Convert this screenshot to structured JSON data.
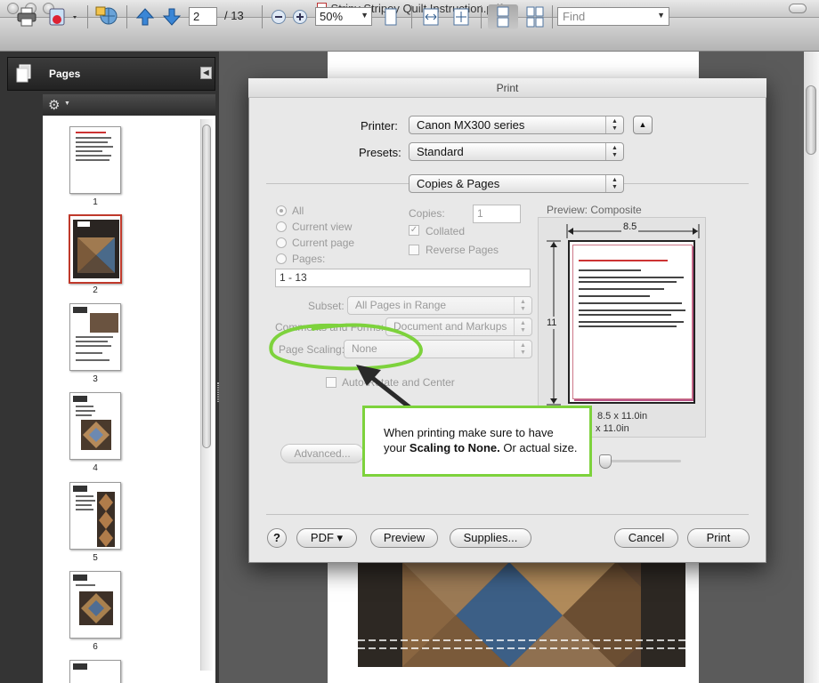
{
  "window": {
    "title": "Stripy Stripey Quilt Instruction.pdf"
  },
  "toolbar": {
    "page_current": "2",
    "page_total": "/ 13",
    "zoom": "50%",
    "find_placeholder": "Find"
  },
  "sidebar": {
    "title": "Pages",
    "thumbnails": [
      {
        "label": "1",
        "selected": false
      },
      {
        "label": "2",
        "selected": true
      },
      {
        "label": "3",
        "selected": false
      },
      {
        "label": "4",
        "selected": false
      },
      {
        "label": "5",
        "selected": false
      },
      {
        "label": "6",
        "selected": false
      }
    ]
  },
  "print_dialog": {
    "title": "Print",
    "printer_label": "Printer:",
    "printer_value": "Canon MX300 series",
    "presets_label": "Presets:",
    "presets_value": "Standard",
    "panel_value": "Copies & Pages",
    "range": {
      "all": "All",
      "current_view": "Current view",
      "current_page": "Current page",
      "pages": "Pages:",
      "pages_value": "1 - 13"
    },
    "copies_label": "Copies:",
    "copies_value": "1",
    "collated_label": "Collated",
    "reverse_label": "Reverse Pages",
    "subset_label": "Subset:",
    "subset_value": "All Pages in Range",
    "comments_label": "Comments and Forms:",
    "comments_value": "Document and Markups",
    "scaling_label": "Page Scaling:",
    "scaling_value": "None",
    "auto_rotate_label": "Auto-Rotate and Center",
    "preview_label": "Preview: Composite",
    "preview_width": "8.5",
    "preview_height": "11",
    "preview_size_line1": "8.5 x 11.0in",
    "preview_size_line2": "x 11.0in",
    "advanced_button": "Advanced...",
    "help_button": "?",
    "pdf_button": "PDF ▾",
    "preview_button": "Preview",
    "supplies_button": "Supplies...",
    "cancel_button": "Cancel",
    "print_button": "Print"
  },
  "annotation": {
    "text_line1": "When printing make sure to have",
    "text_pre": "your ",
    "text_bold": "Scaling to None.",
    "text_post": " Or actual size.",
    "highlight_color": "#7dd23c"
  }
}
